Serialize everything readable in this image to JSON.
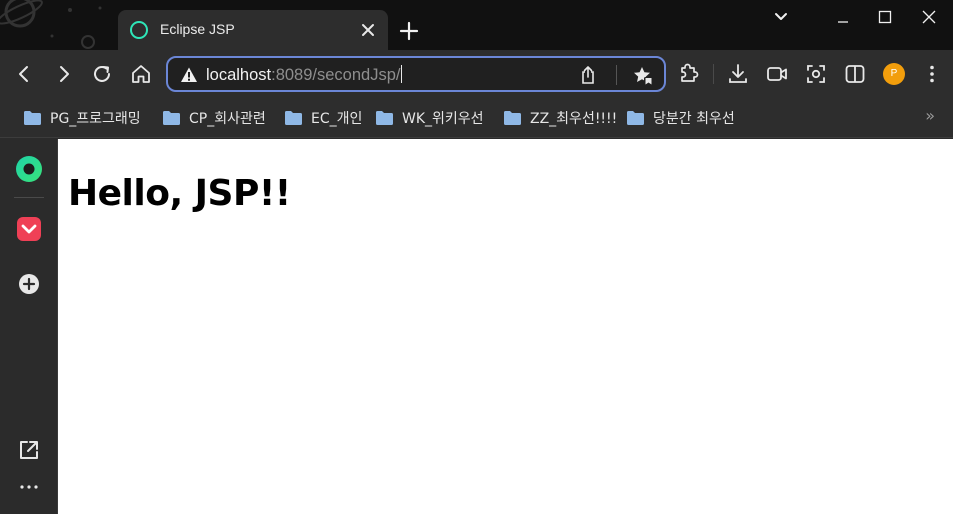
{
  "tab": {
    "title": "Eclipse JSP",
    "icon": "ring-icon"
  },
  "omnibox": {
    "security_icon": "not-secure-warning-icon",
    "url_host": "localhost",
    "url_rest": ":8089/secondJsp/"
  },
  "bookmarks": [
    {
      "label": "PG_프로그래밍",
      "icon": "folder-icon"
    },
    {
      "label": "CP_회사관련",
      "icon": "folder-icon"
    },
    {
      "label": "EC_개인",
      "icon": "folder-icon"
    },
    {
      "label": "WK_위키우선",
      "icon": "folder-icon"
    },
    {
      "label": "ZZ_최우선!!!!",
      "icon": "folder-icon"
    },
    {
      "label": "당분간 최우선",
      "icon": "folder-icon"
    }
  ],
  "bookmarks_more": "»",
  "profile": {
    "initial": "P",
    "color": "#f29e0c"
  },
  "page": {
    "heading": "Hello, JSP!!"
  },
  "colors": {
    "accent": "#6b86d6",
    "tab_icon": "#2ee6b8",
    "folder": "#8fb8e6",
    "pocket": "#ef4056"
  }
}
